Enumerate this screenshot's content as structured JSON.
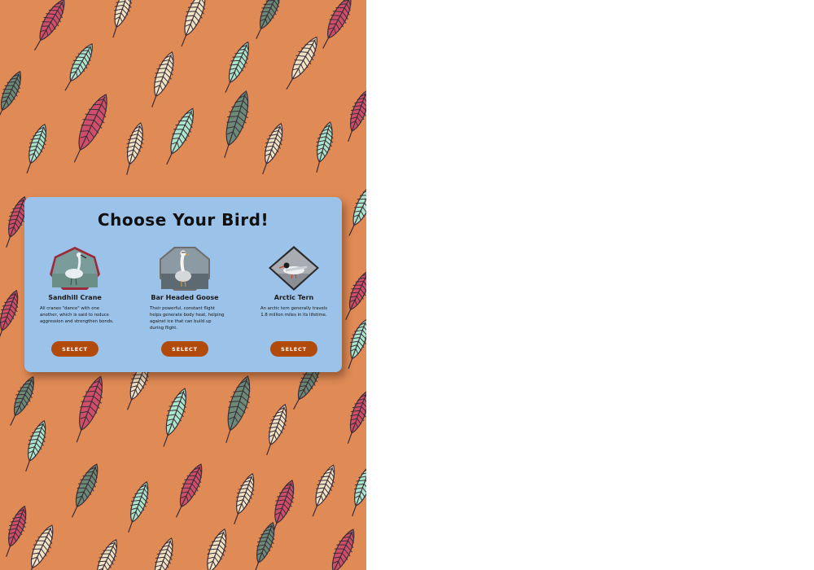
{
  "modal": {
    "title": "Choose Your Bird!"
  },
  "birds": [
    {
      "name": "Sandhill Crane",
      "description": "All cranes \"dance\" with one another, which is said to reduce aggression and strengthen bonds.",
      "select_label": "SELECT",
      "frame_color": "#9b2a3a",
      "frame_shape": "heptagon"
    },
    {
      "name": "Bar Headed Goose",
      "description": "Their powerful, constant flight helps generate body heat, helping against ice that can build up during flight.",
      "select_label": "SELECT",
      "frame_color": "#6f6f6f",
      "frame_shape": "octagon"
    },
    {
      "name": "Arctic Tern",
      "description": "An arctic tern generally travels 1.8 million miles in its lifetime.",
      "select_label": "SELECT",
      "frame_color": "#2a2a2a",
      "frame_shape": "diamond"
    }
  ],
  "colors": {
    "background": "#e08a55",
    "modal": "#9bc3ea",
    "button": "#b24a0c",
    "feather_pink": "#cf4f6b",
    "feather_mint": "#a9e6cb",
    "feather_sage": "#6b8a78",
    "feather_cream": "#efe3c6"
  }
}
